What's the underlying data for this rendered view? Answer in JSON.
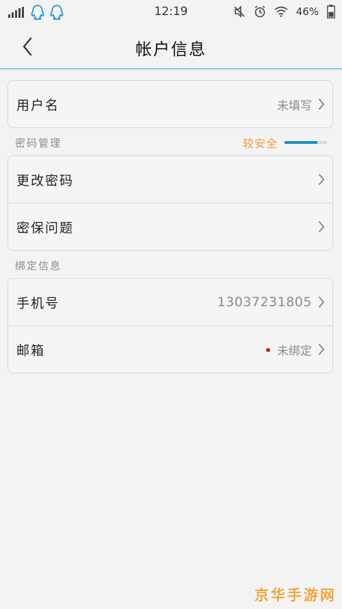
{
  "status_bar": {
    "time": "12:19",
    "battery": "46%",
    "icons": [
      "signal-icon",
      "qq-icon",
      "qq-icon",
      "mute-icon",
      "alarm-icon",
      "wifi-icon"
    ]
  },
  "header": {
    "title": "帐户信息",
    "back_icon": "chevron-left-icon"
  },
  "account": {
    "username_label": "用户名",
    "username_value": "未填写"
  },
  "password_section": {
    "label": "密码管理",
    "strength_text": "较安全",
    "strength_level": 0.78,
    "strength_color": "#f39a3c",
    "items": [
      {
        "label": "更改密码"
      },
      {
        "label": "密保问题"
      }
    ]
  },
  "binding_section": {
    "label": "绑定信息",
    "phone_label": "手机号",
    "phone_value": "13037231805",
    "email_label": "邮箱",
    "email_value": "未绑定"
  },
  "watermark": "京华手游网",
  "colors": {
    "accent": "#2aa1d9",
    "warning_dot": "#d81e1e",
    "background": "#f3f3f3"
  }
}
